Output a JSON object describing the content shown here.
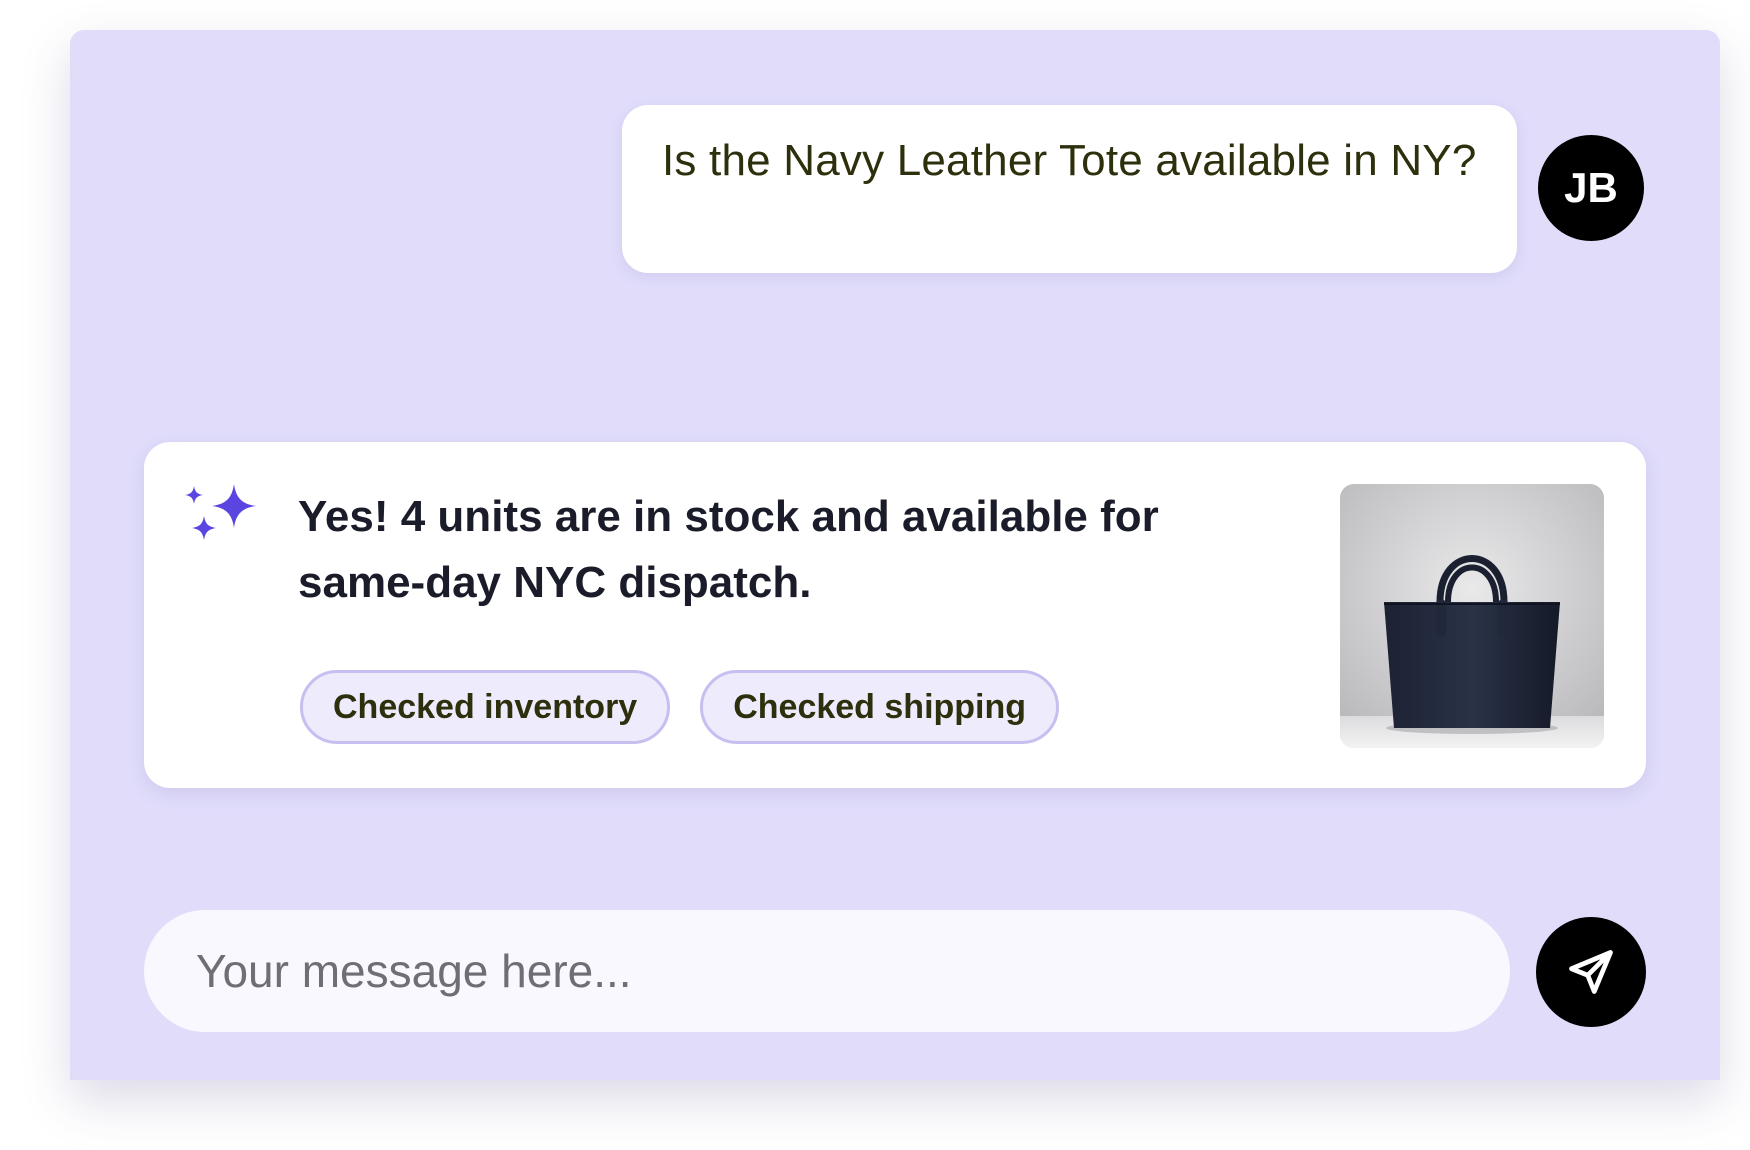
{
  "user_message": {
    "text": "Is the Navy Leather Tote available in NY?",
    "avatar_initials": "JB"
  },
  "assistant_message": {
    "icon": "sparkle-icon",
    "text": "Yes! 4 units are in stock and available for same-day NYC dispatch.",
    "chips": [
      {
        "label": "Checked inventory"
      },
      {
        "label": "Checked shipping"
      }
    ],
    "product_image": "navy-leather-tote"
  },
  "composer": {
    "placeholder": "Your message here...",
    "send_icon": "send-icon"
  },
  "colors": {
    "background": "#e0dcfa",
    "accent": "#5b45e0",
    "chip_fill": "#eeebfd",
    "chip_border": "#c6bff0",
    "avatar": "#000000"
  }
}
